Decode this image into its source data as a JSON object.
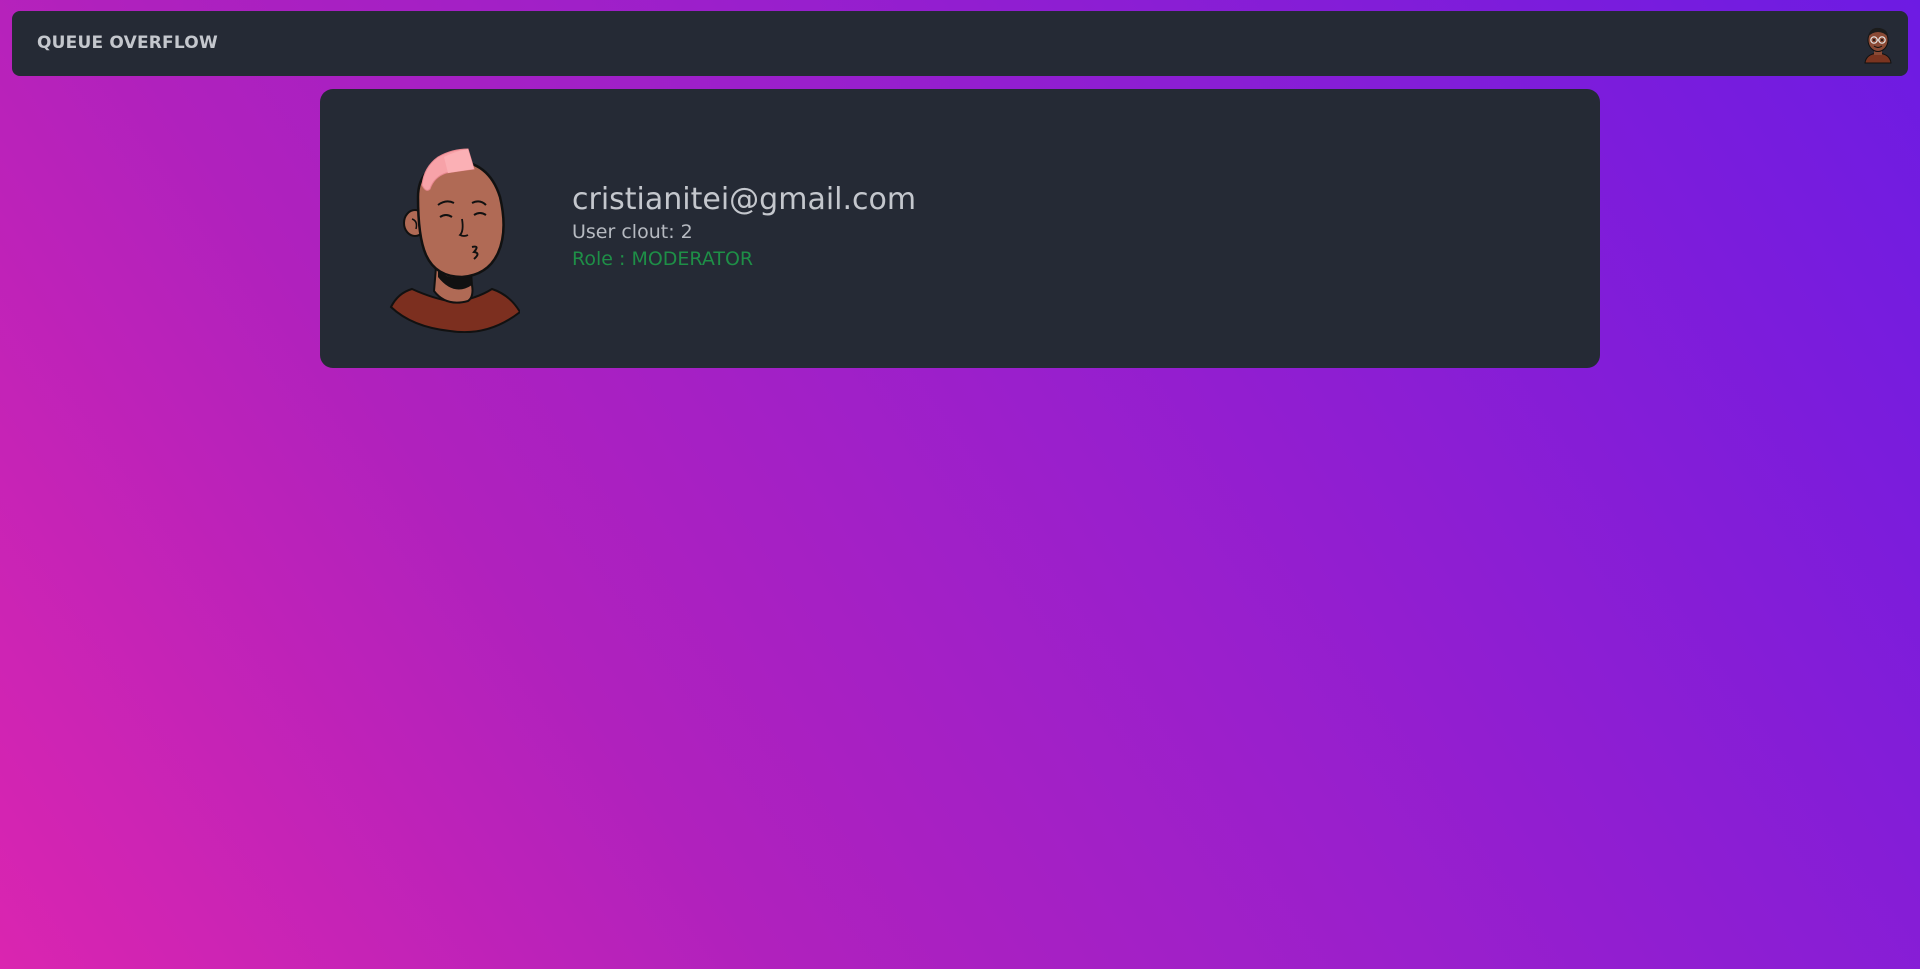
{
  "navbar": {
    "brand": "QUEUE OVERFLOW",
    "avatar_icon": "user-avatar-icon"
  },
  "profile": {
    "avatar_icon": "user-avatar-illustration-icon",
    "email": "cristianitei@gmail.com",
    "clout_label": "User clout:",
    "clout_value": "2",
    "role_label": "Role :",
    "role_value": "MODERATOR"
  },
  "colors": {
    "background_gradient_start": "#da25b0",
    "background_gradient_end": "#6d1be3",
    "panel": "#252a35",
    "text": "#c4c7cd",
    "role": "#1e8f47"
  }
}
